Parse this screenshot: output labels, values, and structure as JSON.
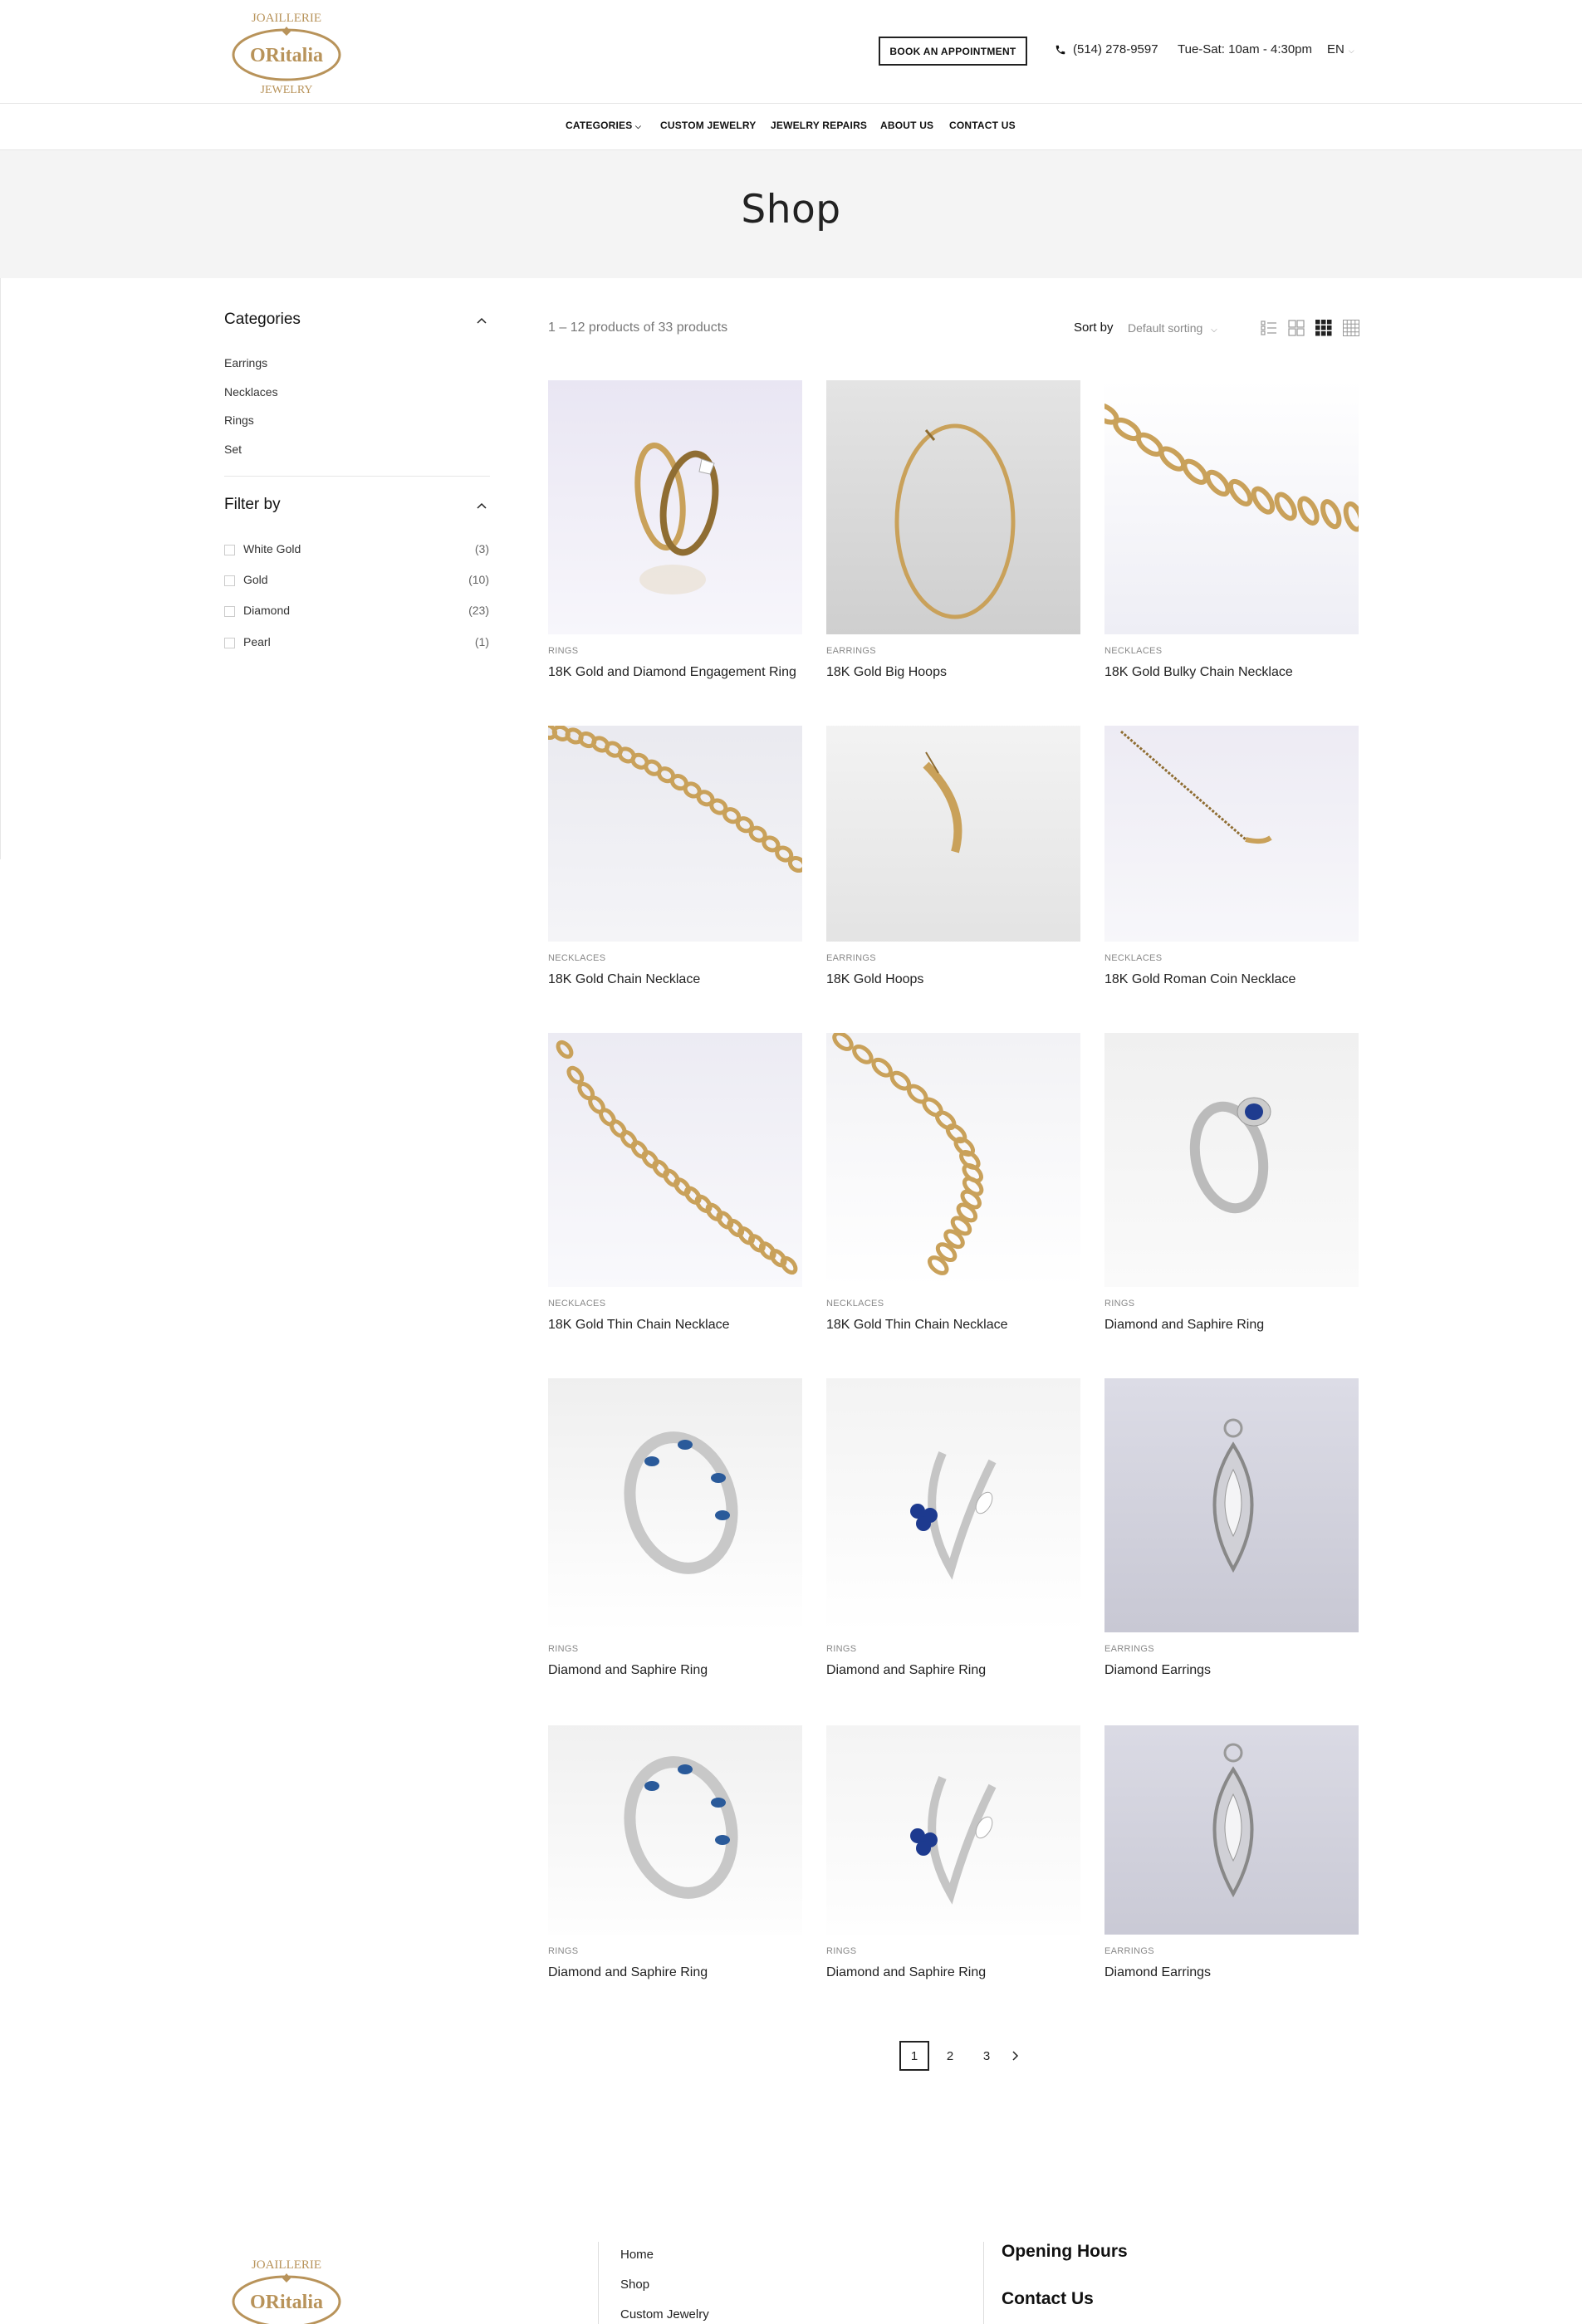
{
  "brand": {
    "logo_top": "JOAILLERIE",
    "logo_name": "ORitalia",
    "logo_bottom": "JEWELRY",
    "gold": "#b8935a"
  },
  "header": {
    "book_label": "BOOK AN APPOINTMENT",
    "phone": "(514) 278-9597",
    "hours": "Tue-Sat: 10am - 4:30pm",
    "lang": "EN"
  },
  "nav": {
    "categories": "CATEGORIES",
    "custom": "CUSTOM JEWELRY",
    "repairs": "JEWELRY REPAIRS",
    "about": "ABOUT US",
    "contact": "CONTACT US"
  },
  "hero": {
    "title": "Shop"
  },
  "sidebar": {
    "categories_title": "Categories",
    "categories": [
      "Earrings",
      "Necklaces",
      "Rings",
      "Set"
    ],
    "filter_title": "Filter by",
    "filters": [
      {
        "label": "White Gold",
        "count": "(3)"
      },
      {
        "label": "Gold",
        "count": "(10)"
      },
      {
        "label": "Diamond",
        "count": "(23)"
      },
      {
        "label": "Pearl",
        "count": "(1)"
      }
    ]
  },
  "toolbar": {
    "count": "1 – 12 products of 33 products",
    "sort_label": "Sort by",
    "sort_value": "Default sorting"
  },
  "products": [
    {
      "category": "RINGS",
      "name": "18K Gold and Diamond Engagement Ring",
      "art": "ring-gold"
    },
    {
      "category": "EARRINGS",
      "name": "18K Gold Big Hoops",
      "art": "hoop-big"
    },
    {
      "category": "NECKLACES",
      "name": "18K Gold Bulky Chain Necklace",
      "art": "chain-bulky"
    },
    {
      "category": "NECKLACES",
      "name": "18K Gold Chain Necklace",
      "art": "chain-box"
    },
    {
      "category": "EARRINGS",
      "name": "18K Gold Hoops",
      "art": "hoop-small"
    },
    {
      "category": "NECKLACES",
      "name": "18K Gold Roman Coin Necklace",
      "art": "chain-coin"
    },
    {
      "category": "NECKLACES",
      "name": "18K Gold Thin Chain Necklace",
      "art": "chain-curb"
    },
    {
      "category": "NECKLACES",
      "name": "18K Gold Thin Chain Necklace",
      "art": "chain-mariner"
    },
    {
      "category": "RINGS",
      "name": "Diamond and Saphire Ring",
      "art": "ring-sapphire-halo"
    },
    {
      "category": "RINGS",
      "name": "Diamond and Saphire Ring",
      "art": "ring-sapphire-band"
    },
    {
      "category": "RINGS",
      "name": "Diamond and Saphire Ring",
      "art": "ring-bypass"
    },
    {
      "category": "EARRINGS",
      "name": "Diamond Earrings",
      "art": "earring-marquise"
    },
    {
      "category": "RINGS",
      "name": "Diamond and Saphire Ring",
      "art": "ring-sapphire-band"
    },
    {
      "category": "RINGS",
      "name": "Diamond and Saphire Ring",
      "art": "ring-bypass"
    },
    {
      "category": "EARRINGS",
      "name": "Diamond Earrings",
      "art": "earring-marquise"
    }
  ],
  "pagination": {
    "pages": [
      "1",
      "2",
      "3"
    ],
    "current": "1"
  },
  "footer": {
    "links": [
      "Home",
      "Shop",
      "Custom Jewelry"
    ],
    "opening_title": "Opening Hours",
    "contact_title": "Contact Us"
  }
}
